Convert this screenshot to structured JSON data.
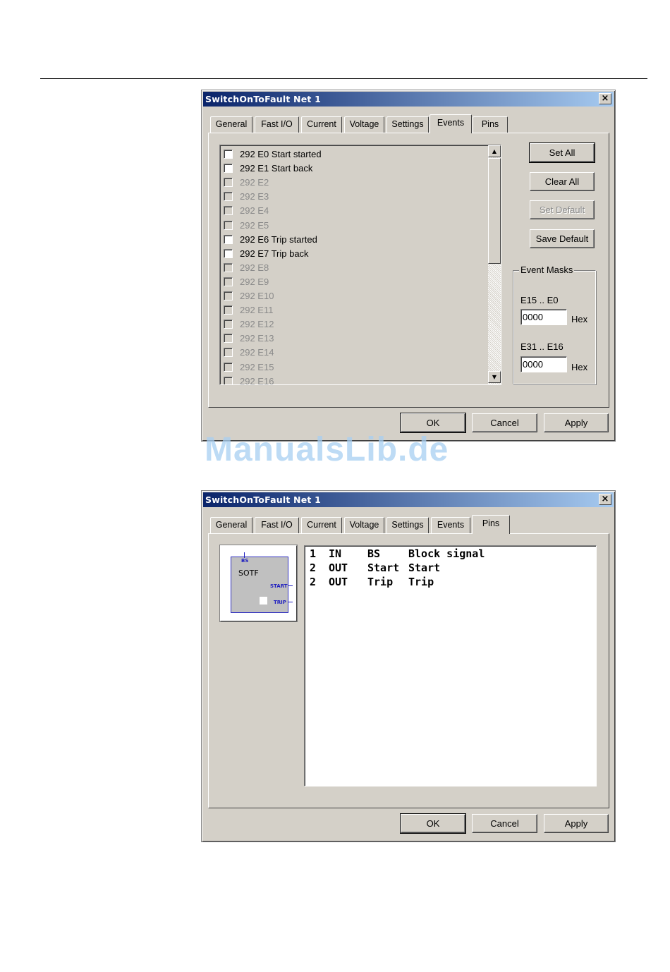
{
  "dialog1": {
    "title": "SwitchOnToFault Net 1",
    "close_symbol": "×",
    "tabs": [
      "General",
      "Fast I/O",
      "Current",
      "Voltage",
      "Settings",
      "Events",
      "Pins"
    ],
    "active_tab": "Events",
    "events": [
      {
        "label": "292 E0 Start started",
        "enabled": true,
        "checked": false
      },
      {
        "label": "292 E1 Start back",
        "enabled": true,
        "checked": false
      },
      {
        "label": "292 E2",
        "enabled": false,
        "checked": false
      },
      {
        "label": "292 E3",
        "enabled": false,
        "checked": false
      },
      {
        "label": "292 E4",
        "enabled": false,
        "checked": false
      },
      {
        "label": "292 E5",
        "enabled": false,
        "checked": false
      },
      {
        "label": "292 E6 Trip started",
        "enabled": true,
        "checked": false
      },
      {
        "label": "292 E7 Trip back",
        "enabled": true,
        "checked": false
      },
      {
        "label": "292 E8",
        "enabled": false,
        "checked": false
      },
      {
        "label": "292 E9",
        "enabled": false,
        "checked": false
      },
      {
        "label": "292 E10",
        "enabled": false,
        "checked": false
      },
      {
        "label": "292 E11",
        "enabled": false,
        "checked": false
      },
      {
        "label": "292 E12",
        "enabled": false,
        "checked": false
      },
      {
        "label": "292 E13",
        "enabled": false,
        "checked": false
      },
      {
        "label": "292 E14",
        "enabled": false,
        "checked": false
      },
      {
        "label": "292 E15",
        "enabled": false,
        "checked": false
      },
      {
        "label": "292 E16",
        "enabled": false,
        "checked": false
      }
    ],
    "scroll_up_symbol": "▲",
    "scroll_down_symbol": "▼",
    "buttons": {
      "set_all": "Set All",
      "clear_all": "Clear All",
      "set_default": "Set Default",
      "save_default": "Save Default"
    },
    "event_masks": {
      "title": "Event Masks",
      "low_label": "E15 .. E0",
      "low_value": "0000",
      "high_label": "E31 .. E16",
      "high_value": "0000",
      "unit": "Hex"
    },
    "footer": {
      "ok": "OK",
      "cancel": "Cancel",
      "apply": "Apply"
    }
  },
  "watermark": "ManualsLib.de",
  "dialog2": {
    "title": "SwitchOnToFault Net 1",
    "close_symbol": "×",
    "tabs": [
      "General",
      "Fast I/O",
      "Current",
      "Voltage",
      "Settings",
      "Events",
      "Pins"
    ],
    "active_tab": "Pins",
    "block": {
      "name": "SOTF",
      "input_pin": "BS",
      "output_pins": [
        "START",
        "TRIP"
      ]
    },
    "pins": [
      {
        "no": "1",
        "dir": "IN",
        "name": "BS",
        "desc": "Block signal"
      },
      {
        "no": "2",
        "dir": "OUT",
        "name": "Start",
        "desc": "Start"
      },
      {
        "no": "2",
        "dir": "OUT",
        "name": "Trip",
        "desc": "Trip"
      }
    ],
    "footer": {
      "ok": "OK",
      "cancel": "Cancel",
      "apply": "Apply"
    }
  }
}
